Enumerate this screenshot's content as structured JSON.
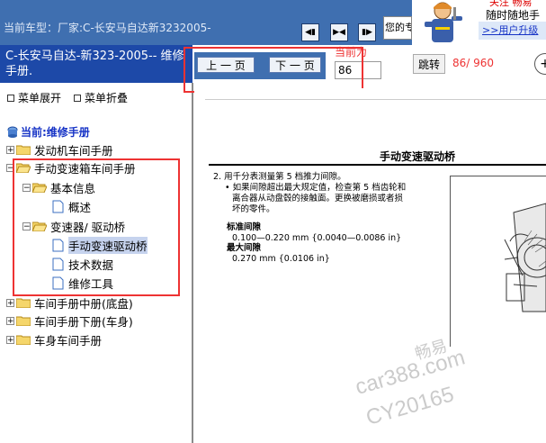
{
  "header": {
    "vehicle_label": "当前车型：",
    "vehicle_value": "厂家:C-长安马自达新3232005-",
    "notice_text": "您的专",
    "toolbar_icons": [
      "page-prev-icon",
      "split-view-icon",
      "page-next-icon"
    ]
  },
  "ad": {
    "line1": "关注 畅易",
    "line2_prefix": "随时",
    "line2_link": "随地手",
    "line3": ">>用户升级"
  },
  "left": {
    "title": "C-长安马自达-新323-2005-- 维修手册.",
    "expand_label": "菜单展开",
    "collapse_label": "菜单折叠",
    "current_manual": "当前:维修手册",
    "tree": [
      {
        "label": "发动机车间手册",
        "expander": "+"
      },
      {
        "label": "手动变速箱车间手册",
        "expander": "−"
      },
      {
        "label": "基本信息",
        "expander": "−"
      },
      {
        "label": "概述",
        "expander": ""
      },
      {
        "label": "变速器/ 驱动桥",
        "expander": "−"
      },
      {
        "label": "手动变速驱动桥",
        "expander": "",
        "selected": true
      },
      {
        "label": "技术数据",
        "expander": ""
      },
      {
        "label": "维修工具",
        "expander": ""
      },
      {
        "label": "车间手册中册(底盘)",
        "expander": "+"
      },
      {
        "label": "车间手册下册(车身)",
        "expander": "+"
      },
      {
        "label": "车身车间手册",
        "expander": "+"
      }
    ]
  },
  "pager": {
    "prev_label": "上 一 页",
    "next_label": "下 一 页",
    "current_label": "当前为",
    "page_value": "86",
    "jump_label": "跳转",
    "page_count": "86/ 960",
    "plus_label": "+"
  },
  "document": {
    "title": "手动变速驱动桥",
    "step": "2.  用千分表测量第 5 档推力间隙。",
    "bullet_line1": "•  如果间隙超出最大规定值，检查第 5 档齿轮和",
    "bullet_line2": "离合器从动盘毂的接触面。更换被磨损或者损",
    "bullet_line3": "坏的零件。",
    "std_label": "标准间隙",
    "std_value": "0.100—0.220 mm {0.0040—0.0086 in}",
    "max_label": "最大间隙",
    "max_value": "0.270 mm {0.0106 in}"
  },
  "watermark": {
    "line1": "畅易",
    "line2": "car388.com",
    "line3": "CY20165"
  },
  "colors": {
    "header_bg": "#3f6fb0",
    "left_title_bg": "#1d49a8",
    "annotation_red": "#e33"
  }
}
